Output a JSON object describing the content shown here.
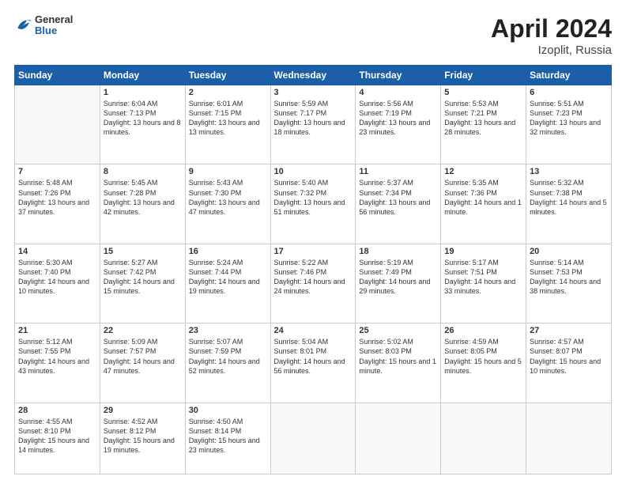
{
  "header": {
    "logo": {
      "general": "General",
      "blue": "Blue"
    },
    "title": "April 2024",
    "location": "Izoplit, Russia"
  },
  "weekdays": [
    "Sunday",
    "Monday",
    "Tuesday",
    "Wednesday",
    "Thursday",
    "Friday",
    "Saturday"
  ],
  "weeks": [
    [
      {
        "day": "",
        "info": ""
      },
      {
        "day": "1",
        "info": "Sunrise: 6:04 AM\nSunset: 7:13 PM\nDaylight: 13 hours\nand 8 minutes."
      },
      {
        "day": "2",
        "info": "Sunrise: 6:01 AM\nSunset: 7:15 PM\nDaylight: 13 hours\nand 13 minutes."
      },
      {
        "day": "3",
        "info": "Sunrise: 5:59 AM\nSunset: 7:17 PM\nDaylight: 13 hours\nand 18 minutes."
      },
      {
        "day": "4",
        "info": "Sunrise: 5:56 AM\nSunset: 7:19 PM\nDaylight: 13 hours\nand 23 minutes."
      },
      {
        "day": "5",
        "info": "Sunrise: 5:53 AM\nSunset: 7:21 PM\nDaylight: 13 hours\nand 28 minutes."
      },
      {
        "day": "6",
        "info": "Sunrise: 5:51 AM\nSunset: 7:23 PM\nDaylight: 13 hours\nand 32 minutes."
      }
    ],
    [
      {
        "day": "7",
        "info": "Sunrise: 5:48 AM\nSunset: 7:26 PM\nDaylight: 13 hours\nand 37 minutes."
      },
      {
        "day": "8",
        "info": "Sunrise: 5:45 AM\nSunset: 7:28 PM\nDaylight: 13 hours\nand 42 minutes."
      },
      {
        "day": "9",
        "info": "Sunrise: 5:43 AM\nSunset: 7:30 PM\nDaylight: 13 hours\nand 47 minutes."
      },
      {
        "day": "10",
        "info": "Sunrise: 5:40 AM\nSunset: 7:32 PM\nDaylight: 13 hours\nand 51 minutes."
      },
      {
        "day": "11",
        "info": "Sunrise: 5:37 AM\nSunset: 7:34 PM\nDaylight: 13 hours\nand 56 minutes."
      },
      {
        "day": "12",
        "info": "Sunrise: 5:35 AM\nSunset: 7:36 PM\nDaylight: 14 hours\nand 1 minute."
      },
      {
        "day": "13",
        "info": "Sunrise: 5:32 AM\nSunset: 7:38 PM\nDaylight: 14 hours\nand 5 minutes."
      }
    ],
    [
      {
        "day": "14",
        "info": "Sunrise: 5:30 AM\nSunset: 7:40 PM\nDaylight: 14 hours\nand 10 minutes."
      },
      {
        "day": "15",
        "info": "Sunrise: 5:27 AM\nSunset: 7:42 PM\nDaylight: 14 hours\nand 15 minutes."
      },
      {
        "day": "16",
        "info": "Sunrise: 5:24 AM\nSunset: 7:44 PM\nDaylight: 14 hours\nand 19 minutes."
      },
      {
        "day": "17",
        "info": "Sunrise: 5:22 AM\nSunset: 7:46 PM\nDaylight: 14 hours\nand 24 minutes."
      },
      {
        "day": "18",
        "info": "Sunrise: 5:19 AM\nSunset: 7:49 PM\nDaylight: 14 hours\nand 29 minutes."
      },
      {
        "day": "19",
        "info": "Sunrise: 5:17 AM\nSunset: 7:51 PM\nDaylight: 14 hours\nand 33 minutes."
      },
      {
        "day": "20",
        "info": "Sunrise: 5:14 AM\nSunset: 7:53 PM\nDaylight: 14 hours\nand 38 minutes."
      }
    ],
    [
      {
        "day": "21",
        "info": "Sunrise: 5:12 AM\nSunset: 7:55 PM\nDaylight: 14 hours\nand 43 minutes."
      },
      {
        "day": "22",
        "info": "Sunrise: 5:09 AM\nSunset: 7:57 PM\nDaylight: 14 hours\nand 47 minutes."
      },
      {
        "day": "23",
        "info": "Sunrise: 5:07 AM\nSunset: 7:59 PM\nDaylight: 14 hours\nand 52 minutes."
      },
      {
        "day": "24",
        "info": "Sunrise: 5:04 AM\nSunset: 8:01 PM\nDaylight: 14 hours\nand 56 minutes."
      },
      {
        "day": "25",
        "info": "Sunrise: 5:02 AM\nSunset: 8:03 PM\nDaylight: 15 hours\nand 1 minute."
      },
      {
        "day": "26",
        "info": "Sunrise: 4:59 AM\nSunset: 8:05 PM\nDaylight: 15 hours\nand 5 minutes."
      },
      {
        "day": "27",
        "info": "Sunrise: 4:57 AM\nSunset: 8:07 PM\nDaylight: 15 hours\nand 10 minutes."
      }
    ],
    [
      {
        "day": "28",
        "info": "Sunrise: 4:55 AM\nSunset: 8:10 PM\nDaylight: 15 hours\nand 14 minutes."
      },
      {
        "day": "29",
        "info": "Sunrise: 4:52 AM\nSunset: 8:12 PM\nDaylight: 15 hours\nand 19 minutes."
      },
      {
        "day": "30",
        "info": "Sunrise: 4:50 AM\nSunset: 8:14 PM\nDaylight: 15 hours\nand 23 minutes."
      },
      {
        "day": "",
        "info": ""
      },
      {
        "day": "",
        "info": ""
      },
      {
        "day": "",
        "info": ""
      },
      {
        "day": "",
        "info": ""
      }
    ]
  ]
}
